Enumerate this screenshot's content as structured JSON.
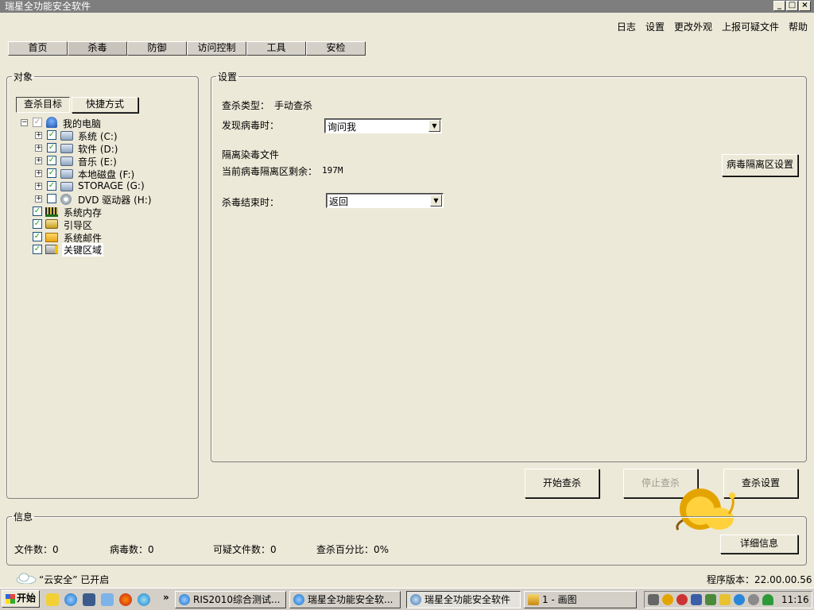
{
  "window": {
    "title": "瑞星全功能安全软件"
  },
  "top_menu": [
    "日志",
    "设置",
    "更改外观",
    "上报可疑文件",
    "帮助"
  ],
  "tabs": [
    "首页",
    "杀毒",
    "防御",
    "访问控制",
    "工具",
    "安检"
  ],
  "objects": {
    "legend": "对象",
    "subtabs": [
      "查杀目标",
      "快捷方式"
    ],
    "tree": {
      "root": "我的电脑",
      "drives": [
        "系统 (C:)",
        "软件 (D:)",
        "音乐 (E:)",
        "本地磁盘 (F:)",
        "STORAGE (G:)",
        "DVD 驱动器 (H:)"
      ],
      "others": [
        "系统内存",
        "引导区",
        "系统邮件",
        "关键区域"
      ]
    }
  },
  "settings": {
    "legend": "设置",
    "scan_type_label": "查杀类型：",
    "scan_type_value": "手动查杀",
    "virus_found_label": "发现病毒时：",
    "virus_found_value": "询问我",
    "quarantine_title": "隔离染毒文件",
    "quarantine_remaining_label": "当前病毒隔离区剩余：",
    "quarantine_remaining_value": "197M",
    "quarantine_button": "病毒隔离区设置",
    "scan_end_label": "杀毒结束时：",
    "scan_end_value": "返回"
  },
  "actions": {
    "start": "开始查杀",
    "stop": "停止查杀",
    "settings": "查杀设置"
  },
  "info": {
    "legend": "信息",
    "files_label": "文件数：0",
    "virus_label": "病毒数：0",
    "suspicious_label": "可疑文件数：0",
    "progress_label": "查杀百分比：0%",
    "details_button": "详细信息"
  },
  "status": {
    "cloud": "“云安全” 已开启",
    "version": "程序版本：22.00.00.56"
  },
  "taskbar": {
    "start": "开始",
    "tasks": [
      "RIS2010综合测试...",
      "瑞星全功能安全软...",
      "瑞星全功能安全软件",
      "1 - 画图"
    ],
    "clock": "11:16",
    "overflow": "»"
  }
}
